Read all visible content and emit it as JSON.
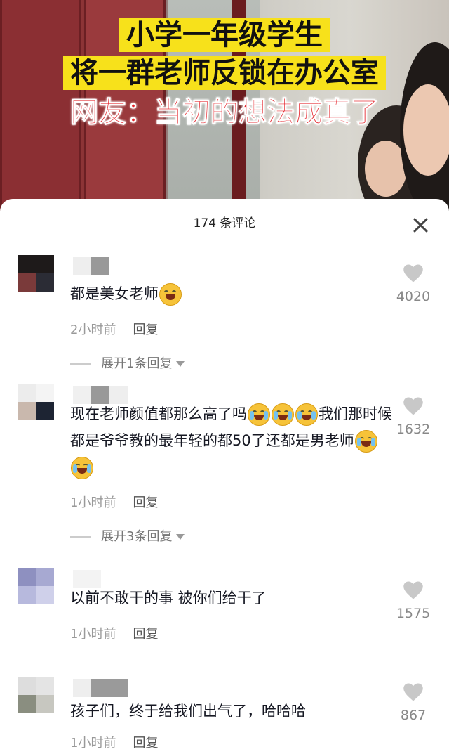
{
  "video": {
    "caption_line1": "小学一年级学生",
    "caption_line2": "将一群老师反锁在办公室",
    "caption_line3": "网友：当初的想法成真了",
    "caption_bg": "#f7e11b",
    "caption_accent": "#e4232a"
  },
  "sheet": {
    "title": "174 条评论",
    "close_icon": "close-icon"
  },
  "comments": [
    {
      "text": "都是美女老师",
      "emoji": "pleading-face-emoji",
      "time": "2小时前",
      "reply_label": "回复",
      "likes": "4020",
      "expand_label": "展开1条回复"
    },
    {
      "text_part1": "现在老师颜值都那么高了吗",
      "text_part2": "我们那时候都是爷爷教的最年轻的都50了还都是男老师",
      "emoji": "rolling-laughing-emoji",
      "time": "1小时前",
      "reply_label": "回复",
      "likes": "1632",
      "expand_label": "展开3条回复"
    },
    {
      "text": "以前不敢干的事 被你们给干了",
      "time": "1小时前",
      "reply_label": "回复",
      "likes": "1575"
    },
    {
      "text": "孩子们，终于给我们出气了，哈哈哈",
      "time": "1小时前",
      "reply_label": "回复",
      "likes": "867"
    }
  ]
}
